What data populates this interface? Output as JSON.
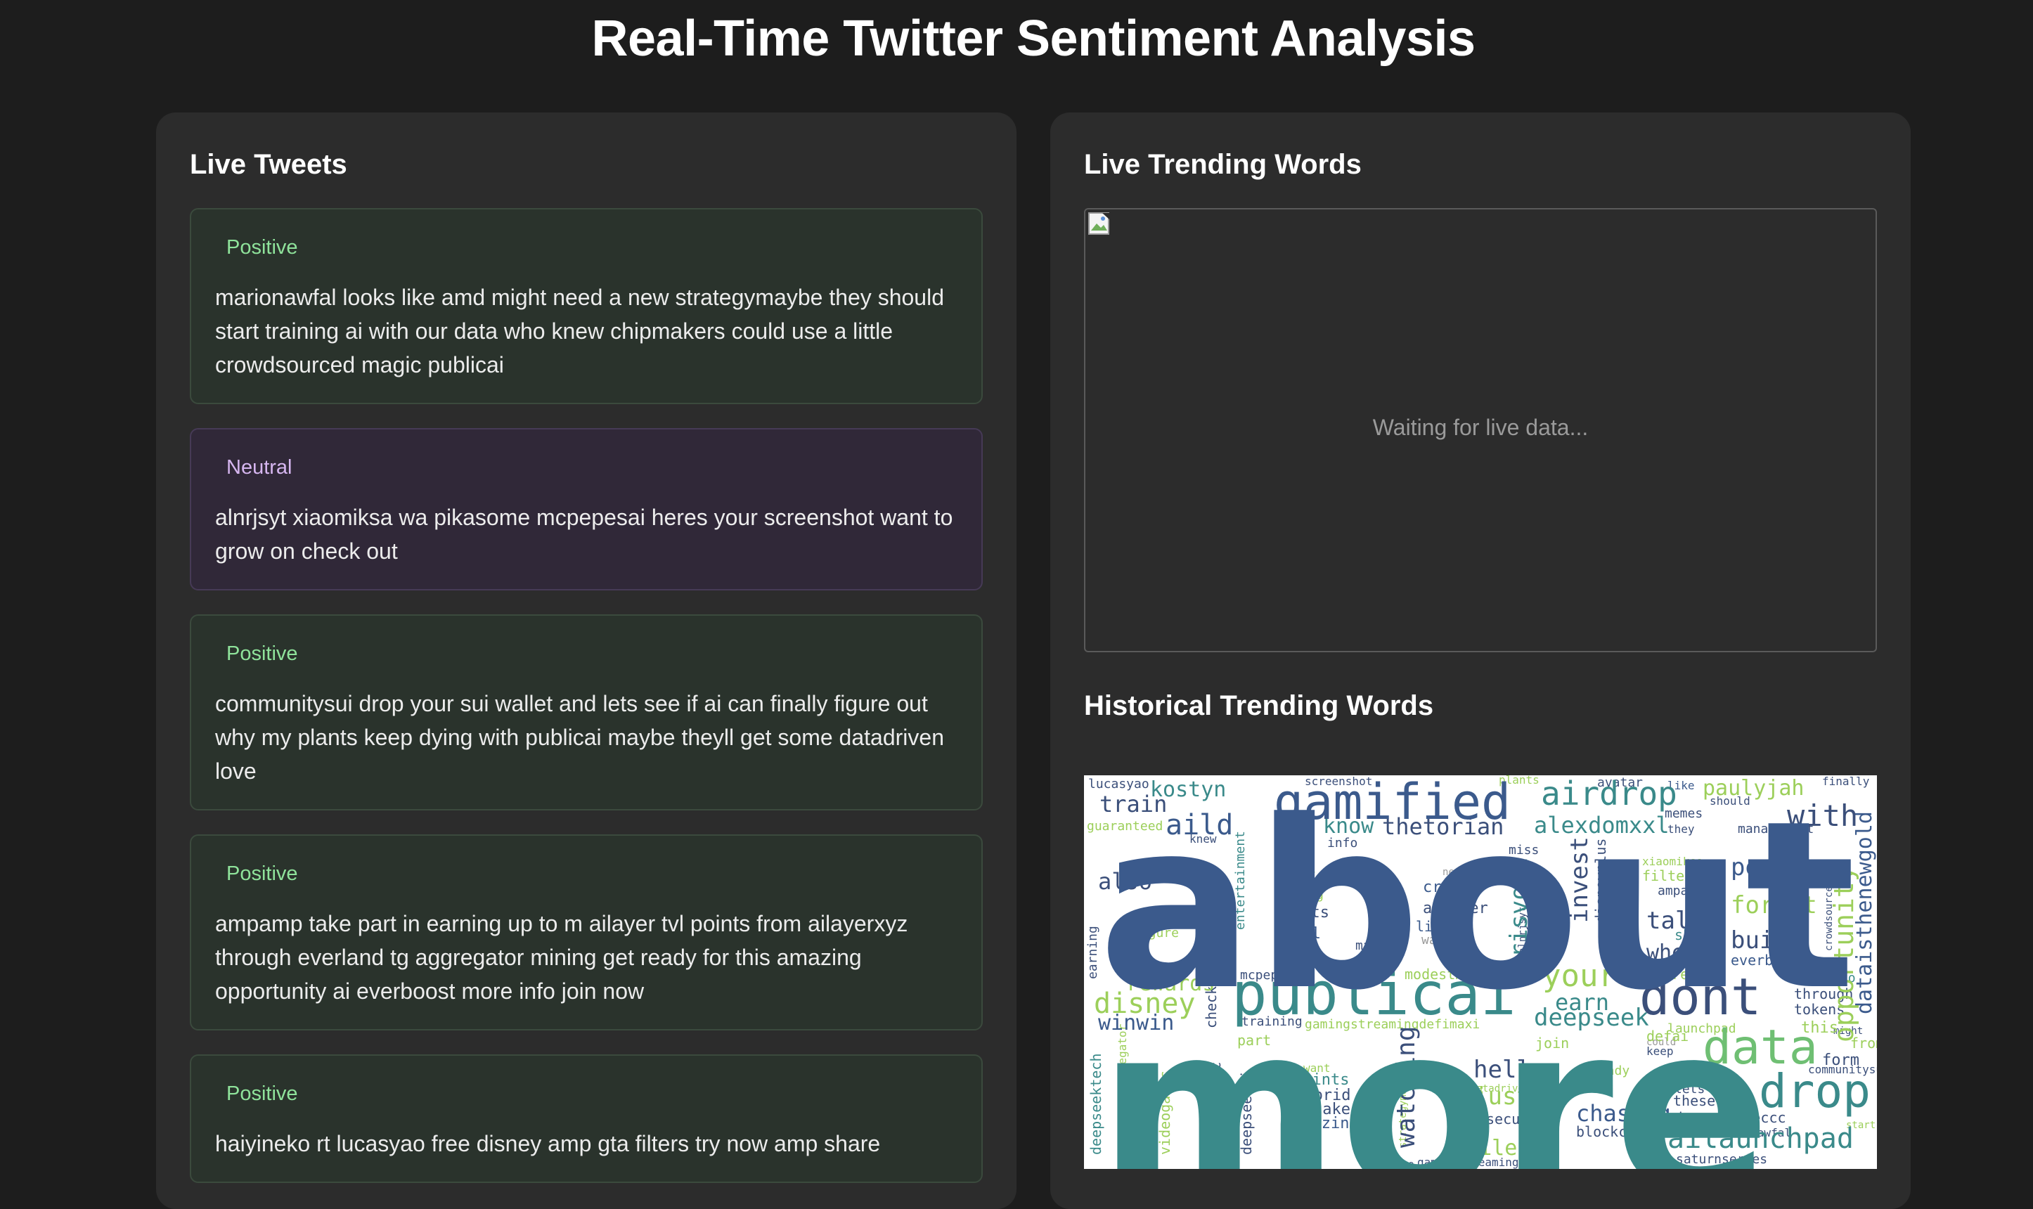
{
  "header": {
    "title": "Real-Time Twitter Sentiment Analysis"
  },
  "live_tweets": {
    "heading": "Live Tweets",
    "items": [
      {
        "sentiment": "Positive",
        "text": "marionawfal looks like amd might need a new strategymaybe they should start training ai with our data who knew chipmakers could use a little crowdsourced magic publicai"
      },
      {
        "sentiment": "Neutral",
        "text": "alnrjsyt xiaomiksa wa pikasome mcpepesai heres your screenshot want to grow on check out"
      },
      {
        "sentiment": "Positive",
        "text": "communitysui drop your sui wallet and lets see if ai can finally figure out why my plants keep dying with publicai maybe theyll get some datadriven love"
      },
      {
        "sentiment": "Positive",
        "text": "ampamp take part in earning up to m ailayer tvl points from ailayerxyz through everland tg aggregator mining get ready for this amazing opportunity ai everboost more info join now"
      },
      {
        "sentiment": "Positive",
        "text": "haiyineko rt lucasyao free disney amp gta filters try now amp share"
      }
    ]
  },
  "live_trending": {
    "heading": "Live Trending Words",
    "waiting_text": "Waiting for live data...",
    "broken_image_icon": "broken-image-icon"
  },
  "historical_trending": {
    "heading": "Historical Trending Words",
    "words": [
      "about",
      "more",
      "publicai",
      "gamified",
      "dont",
      "data",
      "drop",
      "airdrop",
      "disney",
      "deepseek",
      "your",
      "ailaunchpad",
      "with",
      "people",
      "forget",
      "talk",
      "build",
      "also",
      "aild",
      "train",
      "kostyn",
      "know",
      "thetorian",
      "alexdomxxl",
      "paulyjah",
      "winwin",
      "rewards",
      "hello",
      "just",
      "chasing",
      "while",
      "watching",
      "earn",
      "invest",
      "crisvond",
      "opportunity",
      "dataisthenewgold",
      "when",
      "youre",
      "hybrid",
      "points",
      "take",
      "amazing",
      "nfts",
      "fill",
      "crypto",
      "ailayer",
      "live",
      "wallet",
      "security",
      "blockchain",
      "thesevens",
      "jamesmageeccc",
      "saturnseries",
      "marionawfal",
      "communitysui",
      "tokens",
      "through",
      "haiyineko",
      "everboost",
      "management",
      "finally",
      "should",
      "like",
      "memes",
      "they",
      "avatar",
      "plants",
      "screenshot",
      "lucasyao",
      "guaranteed",
      "info",
      "miss",
      "grow",
      "gaming",
      "content",
      "magic",
      "free",
      "modestminer",
      "mcpepesai",
      "training",
      "gamingstreamingdefimaxi",
      "join",
      "defai",
      "keep",
      "could",
      "lets",
      "form",
      "from",
      "this",
      "some",
      "there",
      "share",
      "ampamp",
      "filters",
      "xiaomiksa",
      "disneyplus",
      "deepseekai",
      "deepseektech",
      "everland",
      "videogames",
      "disneymagic",
      "entertainment",
      "figure",
      "maybe",
      "knew",
      "need",
      "want",
      "ready",
      "launchpad",
      "part",
      "check",
      "love",
      "dying",
      "earning",
      "strategymaybe",
      "theyll",
      "datadriven",
      "alnrjsyt",
      "crowdsourced",
      "gamingstreaming",
      "might",
      "start",
      "pikasome",
      "aggregator"
    ]
  },
  "colors": {
    "page_bg": "#1d1d1d",
    "panel_bg": "#2c2c2c",
    "positive_card_bg": "#2a332c",
    "positive_label": "#8fe39b",
    "neutral_card_bg": "#302838",
    "neutral_label": "#d6b6f0",
    "wordcloud_primary": "#3b5a8c",
    "wordcloud_teal": "#3a8a8a",
    "wordcloud_green": "#9ccf5a"
  }
}
